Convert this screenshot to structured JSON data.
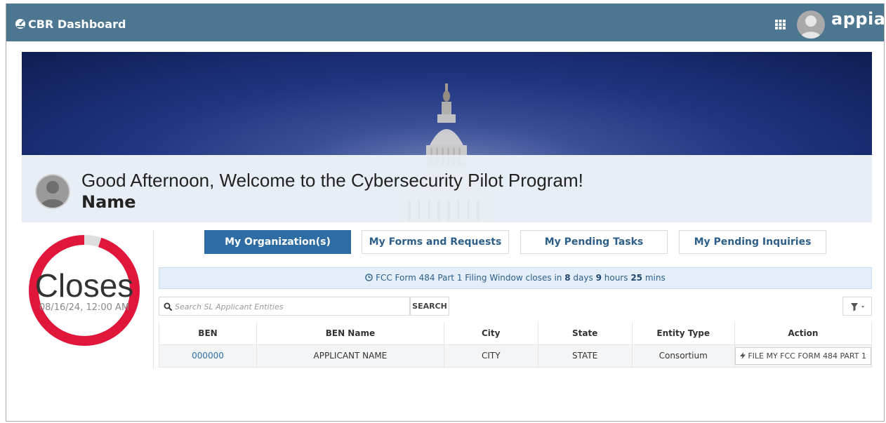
{
  "header": {
    "title": "CBR Dashboard",
    "title_icon": "dashboard-gauge-icon",
    "apps_icon": "grid-icon",
    "brand": "appian",
    "colors": {
      "bar": "#4d7691",
      "text": "#ffffff"
    }
  },
  "hero": {
    "greeting": "Good Afternoon, Welcome to the Cybersecurity Pilot Program!",
    "user_name": "Name"
  },
  "deadline": {
    "label": "Closes",
    "date": "08/16/24, 12:00 AM",
    "progress_fraction": 0.95,
    "colors": {
      "ring": "#e0163b",
      "track": "#dddddd"
    }
  },
  "tabs": [
    {
      "label": "My Organization(s)",
      "active": true
    },
    {
      "label": "My Forms and Requests",
      "active": false
    },
    {
      "label": "My Pending Tasks",
      "active": false
    },
    {
      "label": "My Pending Inquiries",
      "active": false
    }
  ],
  "notice": {
    "prefix": "FCC Form 484 Part 1 Filing Window closes in",
    "days": "8",
    "days_label": "days",
    "hours": "9",
    "hours_label": "hours",
    "mins": "25",
    "mins_label": "mins"
  },
  "search": {
    "placeholder": "Search SL Applicant Entities",
    "button_label": "SEARCH"
  },
  "table": {
    "columns": [
      "BEN",
      "BEN Name",
      "City",
      "State",
      "Entity Type",
      "Action"
    ],
    "rows": [
      {
        "ben": "000000",
        "ben_name": "APPLICANT NAME",
        "city": "CITY",
        "state": "STATE",
        "entity_type": "Consortium",
        "action": "FILE MY FCC FORM 484 PART 1"
      }
    ]
  },
  "colors": {
    "accent": "#2e6da4",
    "notice_bg": "#e3eef9"
  }
}
